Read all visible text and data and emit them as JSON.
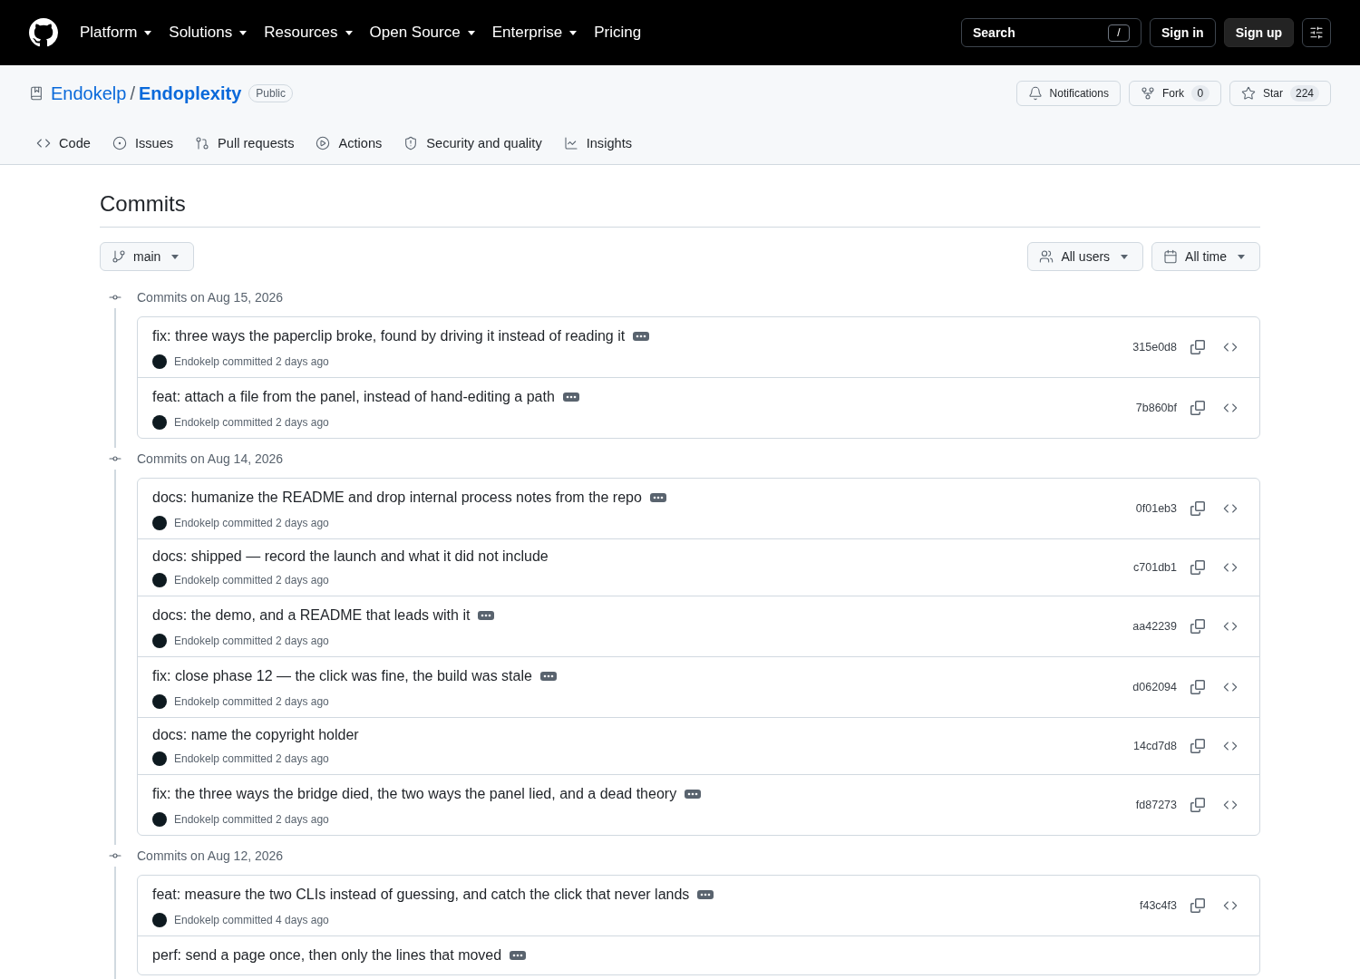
{
  "header": {
    "nav": [
      {
        "label": "Platform",
        "dropdown": true
      },
      {
        "label": "Solutions",
        "dropdown": true
      },
      {
        "label": "Resources",
        "dropdown": true
      },
      {
        "label": "Open Source",
        "dropdown": true
      },
      {
        "label": "Enterprise",
        "dropdown": true
      },
      {
        "label": "Pricing",
        "dropdown": false
      }
    ],
    "search": {
      "label": "Search",
      "shortcut": "/"
    },
    "buttons": [
      {
        "label": "Sign in",
        "kind": "outline"
      },
      {
        "label": "Sign up",
        "kind": "filled"
      }
    ]
  },
  "repo": {
    "owner": "Endokelp",
    "separator": "/",
    "name": "Endoplexity",
    "visibility": "Public",
    "actions": [
      {
        "kind": "notifications",
        "label": "Notifications"
      },
      {
        "kind": "fork",
        "label": "Fork",
        "count": "0"
      },
      {
        "kind": "star",
        "label": "Star",
        "count": "224"
      }
    ]
  },
  "tabs": [
    {
      "kind": "code",
      "label": "Code",
      "selected": false
    },
    {
      "kind": "issues",
      "label": "Issues",
      "selected": false
    },
    {
      "kind": "pulls",
      "label": "Pull requests",
      "selected": false
    },
    {
      "kind": "actions",
      "label": "Actions",
      "selected": false
    },
    {
      "kind": "security",
      "label": "Security and quality",
      "selected": false
    },
    {
      "kind": "insights",
      "label": "Insights",
      "selected": false
    }
  ],
  "page": {
    "title": "Commits",
    "branch": "main",
    "filters": [
      {
        "kind": "users",
        "label": "All users"
      },
      {
        "kind": "time",
        "label": "All time"
      }
    ]
  },
  "groups": [
    {
      "date": "Commits on Aug 15, 2026",
      "commits": [
        {
          "title": "fix: three ways the paperclip broke, found by driving it instead of reading it",
          "expandable": true,
          "meta": "Endokelp committed 2 days ago",
          "sha": "315e0d8"
        },
        {
          "title": "feat: attach a file from the panel, instead of hand-editing a path",
          "expandable": true,
          "meta": "Endokelp committed 2 days ago",
          "sha": "7b860bf"
        }
      ]
    },
    {
      "date": "Commits on Aug 14, 2026",
      "commits": [
        {
          "title": "docs: humanize the README and drop internal process notes from the repo",
          "expandable": true,
          "meta": "Endokelp committed 2 days ago",
          "sha": "0f01eb3"
        },
        {
          "title": "docs: shipped — record the launch and what it did not include",
          "expandable": false,
          "meta": "Endokelp committed 2 days ago",
          "sha": "c701db1"
        },
        {
          "title": "docs: the demo, and a README that leads with it",
          "expandable": true,
          "meta": "Endokelp committed 2 days ago",
          "sha": "aa42239"
        },
        {
          "title": "fix: close phase 12 — the click was fine, the build was stale",
          "expandable": true,
          "meta": "Endokelp committed 2 days ago",
          "sha": "d062094"
        },
        {
          "title": "docs: name the copyright holder",
          "expandable": false,
          "meta": "Endokelp committed 2 days ago",
          "sha": "14cd7d8"
        },
        {
          "title": "fix: the three ways the bridge died, the two ways the panel lied, and a dead theory",
          "expandable": true,
          "meta": "Endokelp committed 2 days ago",
          "sha": "fd87273"
        }
      ]
    },
    {
      "date": "Commits on Aug 12, 2026",
      "commits": [
        {
          "title": "feat: measure the two CLIs instead of guessing, and catch the click that never lands",
          "expandable": true,
          "meta": "Endokelp committed 4 days ago",
          "sha": "f43c4f3"
        },
        {
          "title": "perf: send a page once, then only the lines that moved",
          "expandable": true
        }
      ]
    }
  ]
}
